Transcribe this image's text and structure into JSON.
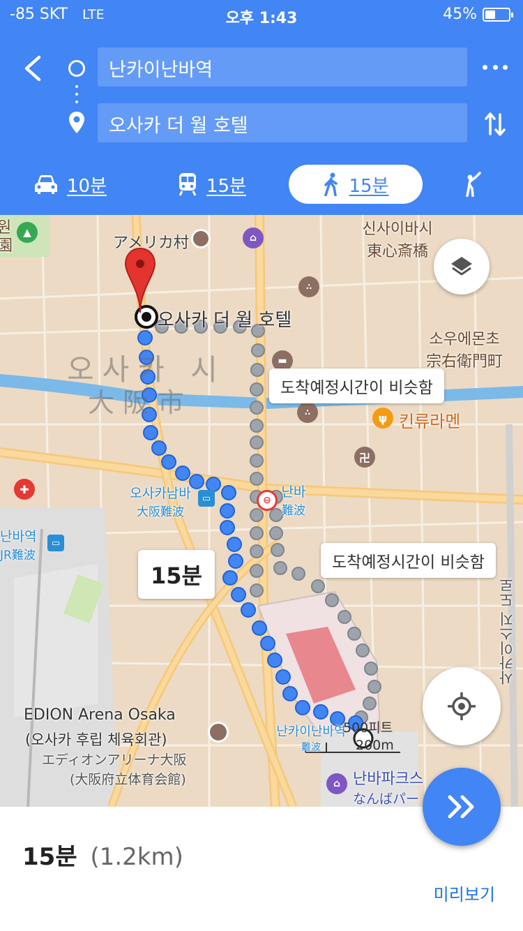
{
  "status_bar": {
    "carrier": "-85 SKT",
    "network": "LTE",
    "time": "오후 1:43",
    "battery": "45%",
    "battery_level": 0.45
  },
  "header": {
    "origin": "난카이난바역",
    "destination": "오사카 더 월 호텔",
    "modes": [
      {
        "name": "car",
        "label": "10분"
      },
      {
        "name": "transit",
        "label": "15분"
      },
      {
        "name": "walk",
        "label": "15분",
        "selected": true
      },
      {
        "name": "assist",
        "label": ""
      }
    ]
  },
  "map": {
    "labels": {
      "america_mura": "アメリカ村",
      "shinsaibashi_ko": "신사이바시",
      "shinsaibashi_ja": "東心斎橋",
      "hotel": "오사카 더 월 호텔",
      "souemon_ko": "소우에몬초",
      "souemon_ja": "宗右衛門町",
      "osaka_city_ko": "오사카 시",
      "osaka_city_ja": "大阪市",
      "kinryu": "킨류라멘",
      "osaka_namba_ko": "오사카남바",
      "osaka_namba_ja": "大阪難波",
      "namba_ko": "난바",
      "namba_ja": "難波",
      "jr_namba_ko": "난바역",
      "jr_namba_ja": "JR難波",
      "sakaisuji": "사카이스지 도로",
      "edion_en": "EDION Arena Osaka",
      "edion_ko": "(오사카 후립 체육회관)",
      "edion_ja1": "エディオンアリーナ大阪",
      "edion_ja2": "(大阪府立体育会館)",
      "nankai_namba_ko": "난카이난바역",
      "nankai_namba_ja": "難波",
      "namba_parks_ko": "난바파크스",
      "namba_parks_ja": "なんばパー",
      "left_edge_1": "원",
      "left_edge_2": "園"
    },
    "callouts": {
      "eta_similar_1": "도착예정시간이 비슷함",
      "eta_similar_2": "도착예정시간이 비슷함",
      "route_time": "15분"
    },
    "scale": {
      "feet": "500피트",
      "meters": "200m"
    },
    "icons": [
      "layers-icon",
      "my-location-icon"
    ]
  },
  "bottom_sheet": {
    "duration": "15분",
    "distance": "(1.2km)",
    "preview_label": "미리보기"
  },
  "colors": {
    "primary": "#4285f4",
    "route_main": "#4285f4",
    "route_alt": "#9ea4ab",
    "marker_red": "#e3342f",
    "link_blue": "#1a73e8"
  }
}
